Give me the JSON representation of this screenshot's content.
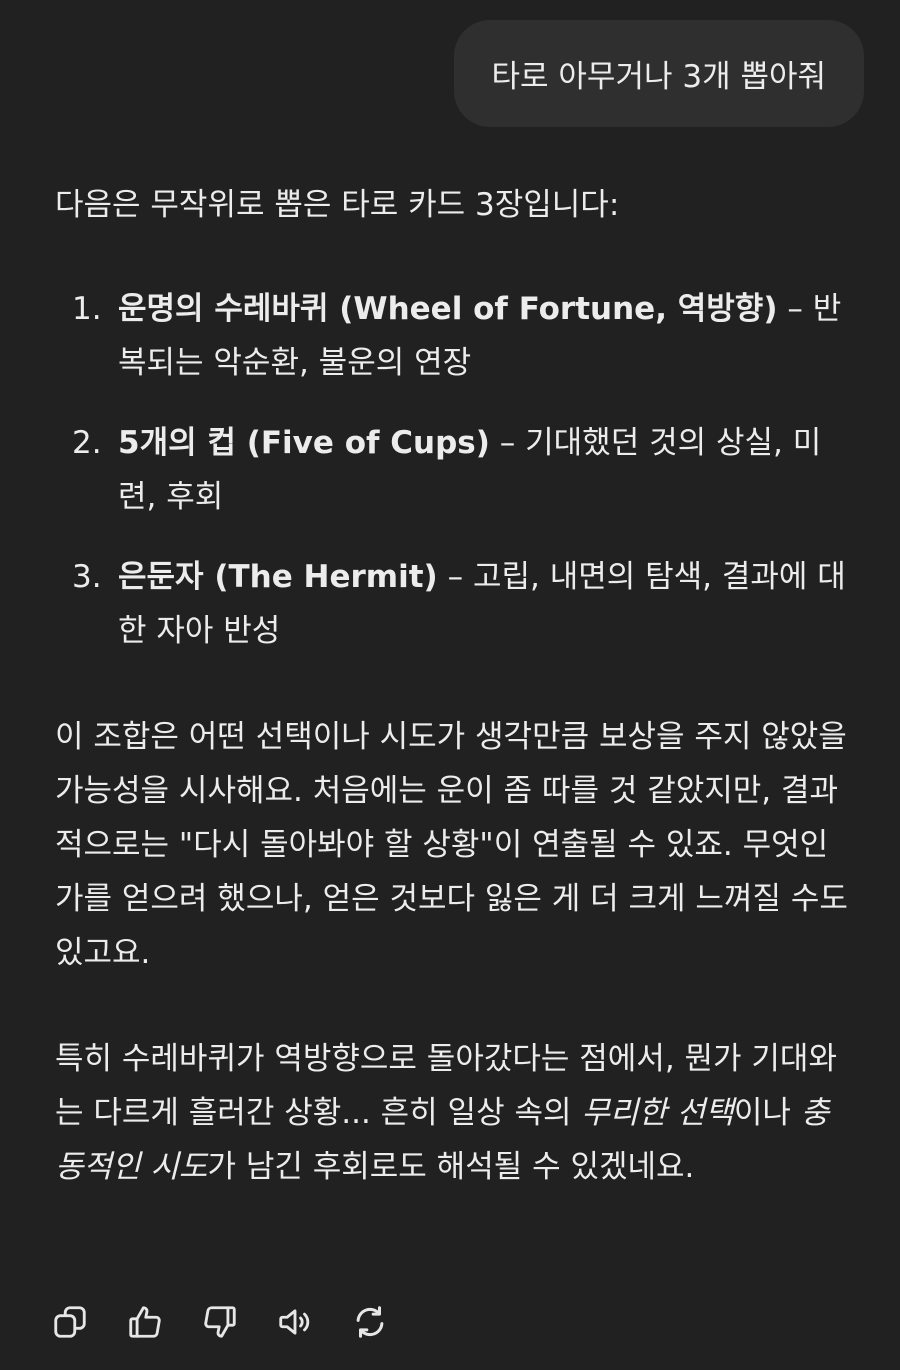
{
  "user_message": "타로 아무거나 3개 뽑아줘",
  "assistant": {
    "intro": "다음은 무작위로 뽑은 타로 카드 3장입니다:",
    "cards": [
      {
        "number": "1.",
        "name": "운명의 수레바퀴 (Wheel of Fortune, 역방향)",
        "desc": " – 반복되는 악순환, 불운의 연장"
      },
      {
        "number": "2.",
        "name": "5개의 컵 (Five of Cups)",
        "desc": " – 기대했던 것의 상실, 미련, 후회"
      },
      {
        "number": "3.",
        "name": "은둔자 (The Hermit)",
        "desc": " – 고립, 내면의 탐색, 결과에 대한 자아 반성"
      }
    ],
    "paragraph1": "이 조합은 어떤 선택이나 시도가 생각만큼 보상을 주지 않았을 가능성을 시사해요. 처음에는 운이 좀 따를 것 같았지만, 결과적으로는 \"다시 돌아봐야 할 상황\"이 연출될 수 있죠. 무엇인가를 얻으려 했으나, 얻은 것보다 잃은 게 더 크게 느껴질 수도 있고요.",
    "paragraph2": {
      "part1": "특히 수레바퀴가 역방향으로 돌아갔다는 점에서, 뭔가 기대와는 다르게 흘러간 상황... 흔히 일상 속의 ",
      "em1": "무리한 선택",
      "part2": "이나 ",
      "em2": "충동적인 시도",
      "part3": "가 남긴 후회로도 해석될 수 있겠네요."
    }
  },
  "actions": [
    {
      "icon": "copy-icon"
    },
    {
      "icon": "thumbs-up-icon"
    },
    {
      "icon": "thumbs-down-icon"
    },
    {
      "icon": "speaker-icon"
    },
    {
      "icon": "regenerate-icon"
    }
  ]
}
